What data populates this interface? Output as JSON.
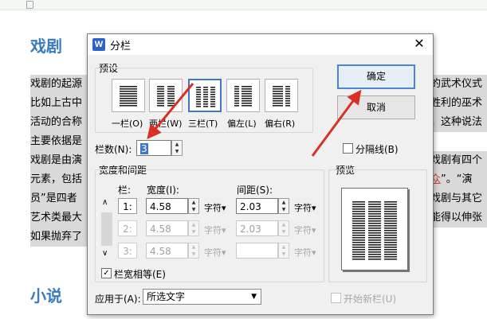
{
  "document": {
    "heading1": "戏剧",
    "heading2": "小说",
    "lines_left": [
      "戏剧的起源",
      "比如上古中",
      "活动的合称",
      "主要依据是",
      "戏剧是由演",
      "元素，包括",
      "员”是四者",
      "艺术类最大",
      "如果抛弃了"
    ],
    "lines_right": [
      "的武术仪式",
      "胜利的巫术",
      "，这种说法",
      "",
      "戏剧有四个",
      "众”。“演",
      "戏剧与其它",
      "能得以伸张",
      ""
    ],
    "right_red": "众"
  },
  "dialog": {
    "title": "分栏",
    "app_icon_letter": "W",
    "presets_label": "预设",
    "presets": [
      {
        "label": "一栏(O)",
        "icon": "one-column-icon"
      },
      {
        "label": "两栏(W)",
        "icon": "two-column-icon"
      },
      {
        "label": "三栏(T)",
        "icon": "three-column-icon"
      },
      {
        "label": "偏左(L)",
        "icon": "left-column-icon"
      },
      {
        "label": "偏右(R)",
        "icon": "right-column-icon"
      }
    ],
    "ok_label": "确定",
    "cancel_label": "取消",
    "column_count_label": "栏数(N):",
    "column_count_value": "3",
    "separator_label": "分隔线(B)",
    "width_spacing_label": "宽度和间距",
    "col_header": "栏:",
    "width_header": "宽度(I):",
    "spacing_header": "间距(S):",
    "rows": [
      {
        "num": "1:",
        "width": "4.58",
        "unit1": "字符",
        "spacing": "2.03",
        "unit2": "字符",
        "enabled": true
      },
      {
        "num": "2:",
        "width": "4.58",
        "unit1": "字符",
        "spacing": "2.03",
        "unit2": "字符",
        "enabled": false
      },
      {
        "num": "3:",
        "width": "4.58",
        "unit1": "字符",
        "spacing": "",
        "unit2": "字符",
        "enabled": false
      }
    ],
    "equal_width_label": "栏宽相等(E)",
    "preview_label": "预览",
    "apply_to_label": "应用于(A):",
    "apply_to_value": "所选文字",
    "new_column_label": "开始新栏(U)"
  },
  "colors": {
    "accent": "#3d78c8",
    "heading": "#3a7bbf",
    "arrow": "#d93025",
    "highlight": "#d9d9d9"
  }
}
